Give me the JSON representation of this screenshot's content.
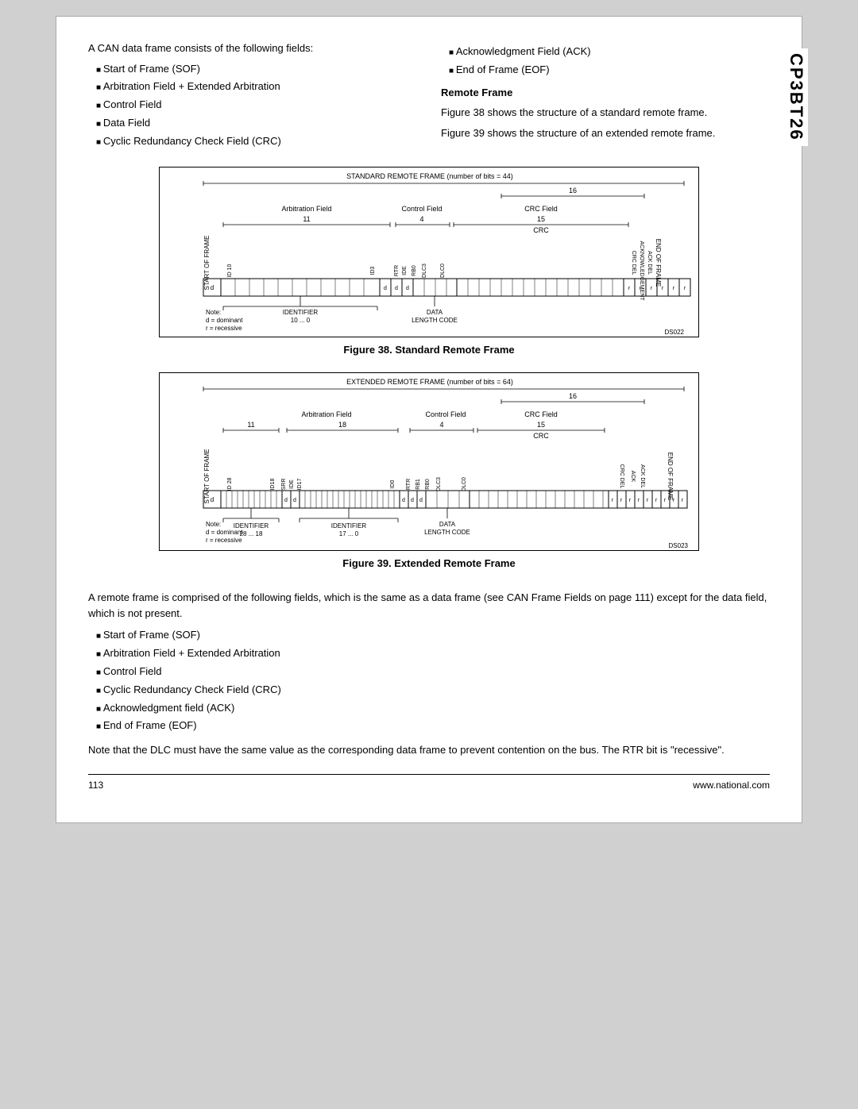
{
  "page": {
    "side_label": "CP3BT26",
    "intro": "A CAN data frame consists of the following fields:",
    "left_bullets": [
      "Start of Frame (SOF)",
      "Arbitration Field + Extended Arbitration",
      "Control Field",
      "Data Field",
      "Cyclic Redundancy Check Field (CRC)"
    ],
    "right_bullets": [
      "Acknowledgment Field (ACK)",
      "End of Frame (EOF)"
    ],
    "remote_frame_heading": "Remote Frame",
    "remote_frame_desc1": "Figure 38 shows the structure of a standard remote frame.",
    "remote_frame_desc2": "Figure 39 shows the structure of an extended remote frame.",
    "fig38_caption": "Figure 38.   Standard Remote Frame",
    "fig39_caption": "Figure 39.   Extended Remote Frame",
    "std_title": "STANDARD REMOTE FRAME (number of bits = 44)",
    "ext_title": "EXTENDED REMOTE FRAME (number of bits = 64)",
    "std_ds": "DS022",
    "ext_ds": "DS023",
    "note1": "Note:",
    "note2": "d = dominant",
    "note3": "r = recessive",
    "bottom_intro": "A remote frame is comprised of the following fields, which is the same as a data frame (see CAN Frame Fields on page 111) except for the data field, which is not present.",
    "bottom_bullets": [
      "Start of Frame (SOF)",
      "Arbitration Field + Extended Arbitration",
      "Control Field",
      "Cyclic Redundancy Check Field (CRC)",
      "Acknowledgment field (ACK)",
      "End of Frame (EOF)"
    ],
    "dlc_note": "Note that the DLC must have the same value as the corresponding data frame to prevent contention on the bus. The RTR bit is \"recessive\".",
    "page_number": "113",
    "website": "www.national.com"
  }
}
